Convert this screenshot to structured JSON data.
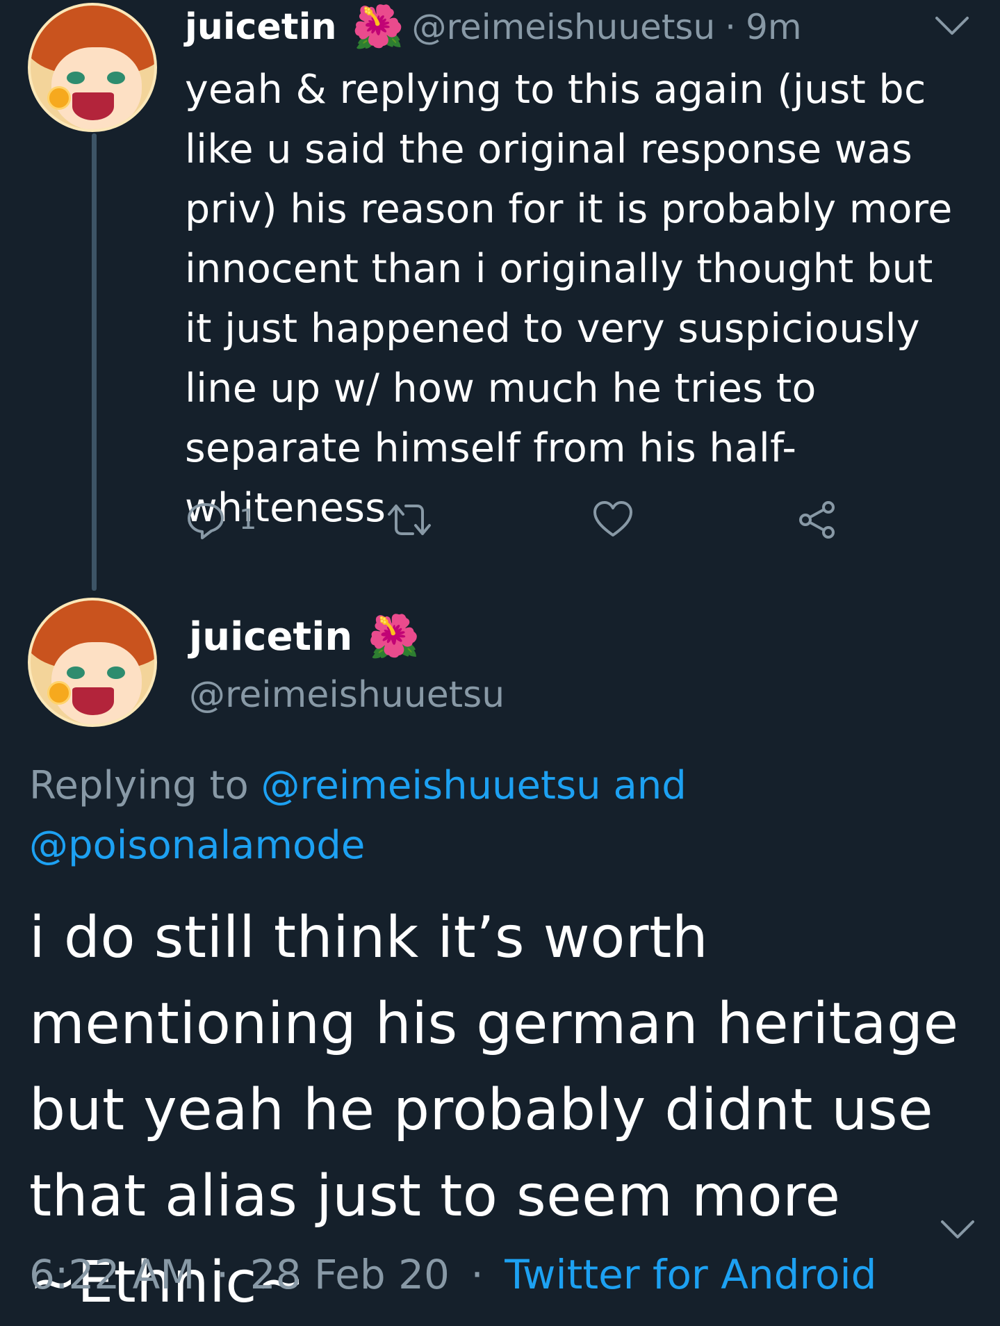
{
  "tweet1": {
    "display_name": "juicetin",
    "name_emoji": "🌺",
    "handle": "@reimeishuuetsu",
    "separator": "·",
    "time": "9m",
    "text": "yeah & replying to this again (just bc like u said the original response was priv) his reason for it is probably more innocent than i originally thought but it just happened to very suspiciously line up w/ how much he tries to separate himself from his half-whiteness",
    "reply_count": "1"
  },
  "tweet2": {
    "display_name": "juicetin",
    "name_emoji": "🌺",
    "handle": "@reimeishuuetsu",
    "replying_prefix": "Replying to",
    "replying_to_1": "@reimeishuuetsu",
    "replying_and": "and",
    "replying_to_2": "@poisonalamode",
    "text": "i do still think it’s worth mentioning his german heritage but yeah he probably didnt use that alias just to seem more ~Ethnic~",
    "time": "6:22 AM",
    "separator1": "·",
    "date": "28 Feb 20",
    "separator2": "·",
    "source": "Twitter for Android"
  },
  "colors": {
    "background": "#15202b",
    "text_primary": "#ffffff",
    "text_secondary": "#8899a6",
    "link": "#1da1f2",
    "thread_line": "#3d5466"
  },
  "icons": [
    "chevron-down-icon",
    "reply-icon",
    "retweet-icon",
    "like-icon",
    "share-icon",
    "hibiscus-emoji"
  ]
}
